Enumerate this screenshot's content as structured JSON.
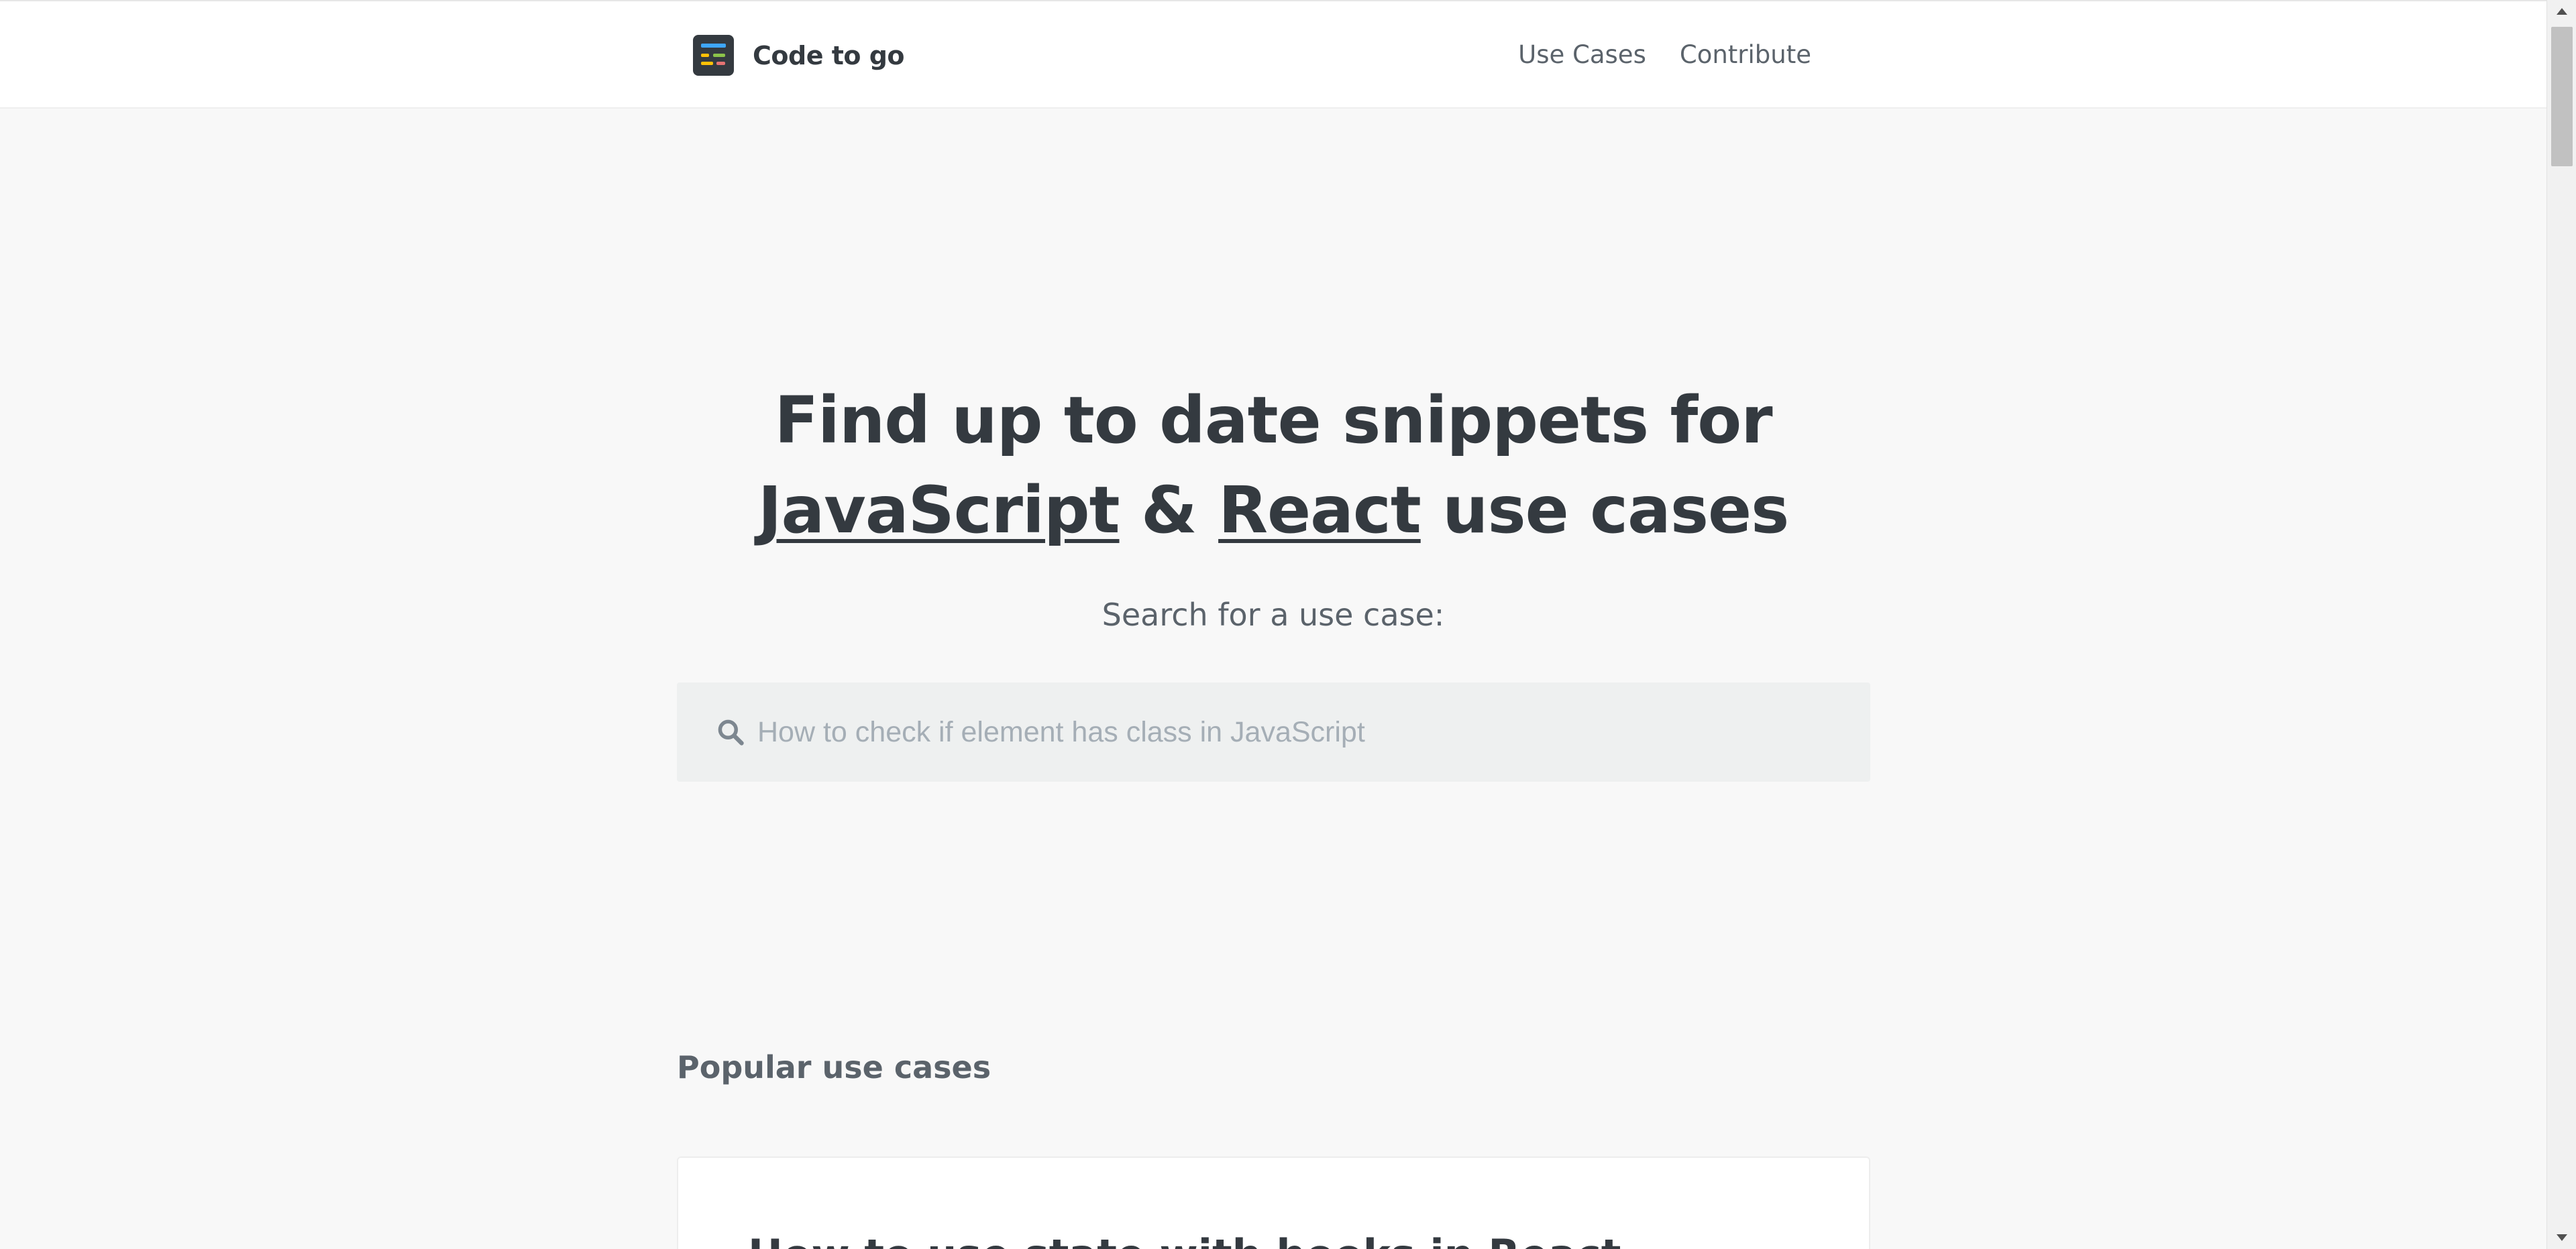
{
  "header": {
    "logo_text": "Code to go",
    "nav": [
      {
        "label": "Use Cases"
      },
      {
        "label": "Contribute"
      }
    ]
  },
  "hero": {
    "title_line1": "Find up to date snippets for",
    "link_javascript": "JavaScript",
    "ampersand": "&",
    "link_react": "React",
    "title_suffix": "use cases",
    "subtitle": "Search for a use case:"
  },
  "search": {
    "placeholder": "How to check if element has class in JavaScript",
    "value": "",
    "icon": "search-icon"
  },
  "popular": {
    "heading": "Popular use cases",
    "cards": [
      {
        "title": "How to use state with hooks in React"
      }
    ]
  },
  "colors": {
    "background": "#f8f8f8",
    "text": "#343a40",
    "muted": "#5b636b",
    "search_bg": "#eef0f0"
  }
}
